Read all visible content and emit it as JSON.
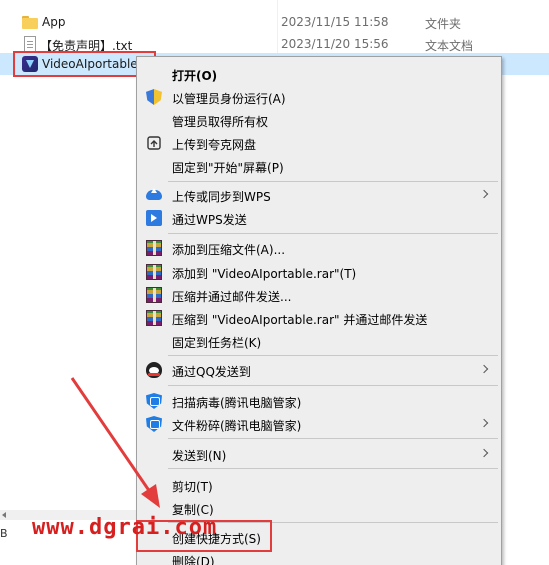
{
  "files": [
    {
      "name": "App",
      "date": "2023/11/15 11:58",
      "type": "文件夹",
      "icon": "folder-icon"
    },
    {
      "name": "【免责声明】.txt",
      "date": "2023/11/20 15:56",
      "type": "文本文档",
      "icon": "txt-icon"
    },
    {
      "name": "VideoAIportable",
      "date": "",
      "type": "",
      "icon": "app-icon"
    }
  ],
  "status_text": "B",
  "context_menu": {
    "open": "打开(O)",
    "run_as_admin": "以管理员身份运行(A)",
    "take_ownership": "管理员取得所有权",
    "upload_quark": "上传到夸克网盘",
    "pin_start": "固定到\"开始\"屏幕(P)",
    "upload_wps": "上传或同步到WPS",
    "send_wps": "通过WPS发送",
    "add_archive": "添加到压缩文件(A)...",
    "add_rar": "添加到 \"VideoAIportable.rar\"(T)",
    "compress_email": "压缩并通过邮件发送...",
    "compress_rar_email": "压缩到 \"VideoAIportable.rar\" 并通过邮件发送",
    "pin_taskbar": "固定到任务栏(K)",
    "send_qq": "通过QQ发送到",
    "scan_virus": "扫描病毒(腾讯电脑管家)",
    "shred_file": "文件粉碎(腾讯电脑管家)",
    "send_to": "发送到(N)",
    "cut": "剪切(T)",
    "copy": "复制(C)",
    "create_shortcut": "创建快捷方式(S)",
    "delete": "删除(D)"
  },
  "watermark": "www.dgrai.com",
  "colors": {
    "selection": "#cce8ff",
    "menu_bg": "#eeeeee",
    "highlight_red": "#e23c3c"
  }
}
